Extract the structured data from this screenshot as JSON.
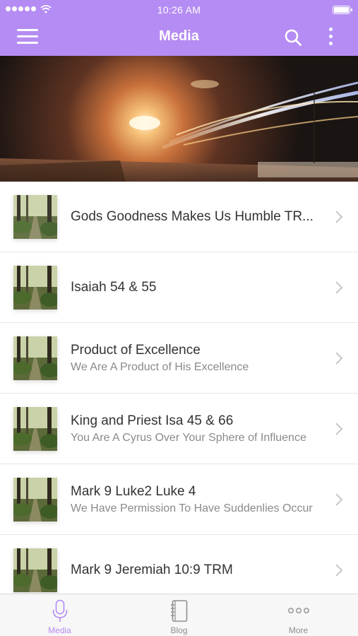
{
  "status_bar": {
    "time": "10:26 AM"
  },
  "header": {
    "title": "Media"
  },
  "icons": {
    "menu": "hamburger-menu-icon",
    "search": "search-icon",
    "more": "vertical-ellipsis-icon",
    "chevron": "chevron-right-icon",
    "thumbnail": "forest-path-thumbnail"
  },
  "colors": {
    "accent": "#b58cf3",
    "title_text": "#333333",
    "subtitle_text": "#8a8a8a"
  },
  "items": [
    {
      "title": "Gods Goodness Makes Us Humble TR...",
      "subtitle": ""
    },
    {
      "title": "Isaiah 54 & 55",
      "subtitle": ""
    },
    {
      "title": "Product of Excellence",
      "subtitle": "We Are A Product of His Excellence"
    },
    {
      "title": "King and Priest Isa 45 & 66",
      "subtitle": "You Are A Cyrus Over Your Sphere of Influence"
    },
    {
      "title": "Mark 9 Luke2 Luke 4",
      "subtitle": "We Have Permission To Have Suddenlies Occur"
    },
    {
      "title": "Mark 9 Jeremiah 10:9 TRM",
      "subtitle": ""
    }
  ],
  "tabs": [
    {
      "label": "Media",
      "icon": "microphone-icon",
      "active": true
    },
    {
      "label": "Blog",
      "icon": "notebook-icon",
      "active": false
    },
    {
      "label": "More",
      "icon": "three-dots-icon",
      "active": false
    }
  ]
}
